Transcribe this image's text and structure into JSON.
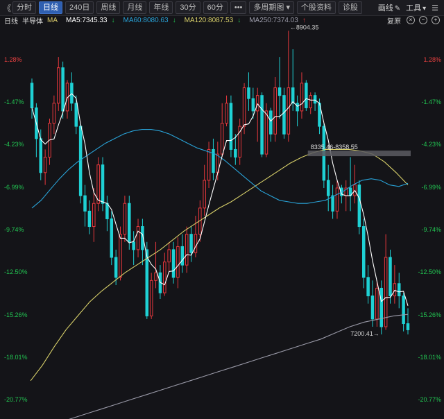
{
  "toolbar": {
    "back": "《",
    "buttons": [
      "分时",
      "日线",
      "240日",
      "周线",
      "月线",
      "年线",
      "30分",
      "60分",
      "•••",
      "多周期图 ▾",
      "个股资料",
      "诊股"
    ],
    "active_index": 1,
    "tools": [
      {
        "label": "画线",
        "icon": "✎"
      },
      {
        "label": "工具",
        "icon": "▾"
      },
      {
        "label": "",
        "icon": "☰"
      }
    ]
  },
  "info": {
    "period": "日线",
    "name": "半导体",
    "ma_label": "MA",
    "ma5": "MA5:7345.33",
    "ma5_arrow": "↓",
    "ma60": "MA60:8080.63",
    "ma60_arrow": "↓",
    "ma120": "MA120:8087.53",
    "ma120_arrow": "↓",
    "ma250": "MA250:7374.03",
    "ma250_arrow": "↑",
    "restore": "复原",
    "colors": {
      "ma5": "#ffffff",
      "ma60": "#29a3d8",
      "ma120": "#d8d06a",
      "ma250": "#9a9aa8",
      "up": "#e8383d",
      "down": "#1fd1d4"
    }
  },
  "axis_labels": {
    "left": [
      "1.28%",
      "-1.47%",
      "-4.23%",
      "-6.99%",
      "-9.74%",
      "-12.50%",
      "-15.26%",
      "-18.01%",
      "-20.77%"
    ],
    "colors": [
      "#e84040",
      "#22c552",
      "#22c552",
      "#22c552",
      "#22c552",
      "#22c552",
      "#22c552",
      "#22c552",
      "#22c552"
    ]
  },
  "annotations": {
    "high": "←8904.35",
    "low": "7200.41→",
    "range": "8335.46-8358.55"
  },
  "chart_data": {
    "type": "candlestick",
    "y_axis": "percent change",
    "y_ticks": [
      1.28,
      -1.47,
      -4.23,
      -6.99,
      -9.74,
      -12.5,
      -15.26,
      -18.01,
      -20.77
    ],
    "ylim": [
      -22.8,
      4.7
    ],
    "candles": [
      [
        -0.2,
        -1.8,
        0.1,
        -2.5
      ],
      [
        -1.8,
        -3.8,
        -1.5,
        -5.0
      ],
      [
        -3.8,
        -6.0,
        -3.2,
        -6.5
      ],
      [
        -6.0,
        -5.0,
        -4.5,
        -6.8
      ],
      [
        -5.0,
        -2.8,
        -2.5,
        -5.5
      ],
      [
        -2.8,
        -1.5,
        -1.0,
        -3.5
      ],
      [
        -1.5,
        0.8,
        1.5,
        -2.0
      ],
      [
        0.8,
        -2.0,
        1.2,
        -2.5
      ],
      [
        -2.0,
        -0.2,
        0.0,
        -2.5
      ],
      [
        -0.2,
        -1.5,
        0.5,
        -2.0
      ],
      [
        -1.5,
        -3.0,
        -1.0,
        -3.5
      ],
      [
        -3.0,
        -7.5,
        -2.8,
        -8.0
      ],
      [
        -7.5,
        -8.5,
        -6.8,
        -9.5
      ],
      [
        -8.5,
        -9.5,
        -7.8,
        -10.0
      ],
      [
        -9.5,
        -8.0,
        -7.0,
        -10.5
      ],
      [
        -8.0,
        -5.5,
        -5.0,
        -8.5
      ],
      [
        -5.5,
        -8.0,
        -5.0,
        -8.5
      ],
      [
        -8.0,
        -9.0,
        -7.5,
        -9.8
      ],
      [
        -9.0,
        -11.5,
        -8.5,
        -12.0
      ],
      [
        -11.5,
        -12.8,
        -11.0,
        -13.3
      ],
      [
        -12.8,
        -10.0,
        -9.5,
        -13.0
      ],
      [
        -10.0,
        -8.0,
        -7.5,
        -10.5
      ],
      [
        -8.0,
        -10.5,
        -7.5,
        -11.0
      ],
      [
        -10.5,
        -11.0,
        -9.8,
        -12.0
      ],
      [
        -11.0,
        -9.5,
        -9.0,
        -11.5
      ],
      [
        -9.5,
        -11.0,
        -9.0,
        -12.0
      ],
      [
        -11.0,
        -15.3,
        -10.5,
        -15.5
      ],
      [
        -15.3,
        -13.0,
        -12.5,
        -15.5
      ],
      [
        -13.0,
        -12.5,
        -10.5,
        -13.5
      ],
      [
        -12.5,
        -13.8,
        -12.0,
        -14.2
      ],
      [
        -13.8,
        -11.8,
        -11.2,
        -14.0
      ],
      [
        -11.8,
        -11.0,
        -10.5,
        -12.5
      ],
      [
        -11.0,
        -12.8,
        -10.5,
        -13.2
      ],
      [
        -12.8,
        -10.8,
        -10.2,
        -13.5
      ],
      [
        -10.8,
        -12.0,
        -10.0,
        -12.5
      ],
      [
        -12.0,
        -10.0,
        -9.5,
        -12.5
      ],
      [
        -10.0,
        -11.2,
        -9.5,
        -11.8
      ],
      [
        -11.2,
        -10.0,
        -8.8,
        -11.5
      ],
      [
        -10.0,
        -8.3,
        -7.8,
        -10.5
      ],
      [
        -8.3,
        -6.5,
        -5.5,
        -8.8
      ],
      [
        -6.5,
        -4.5,
        -4.0,
        -7.0
      ],
      [
        -4.5,
        -6.0,
        -3.8,
        -6.5
      ],
      [
        -6.0,
        -4.8,
        -4.0,
        -6.5
      ],
      [
        -4.8,
        -2.8,
        -1.5,
        -5.0
      ],
      [
        -2.8,
        -1.5,
        -1.0,
        -3.0
      ],
      [
        -1.5,
        -4.5,
        -1.0,
        -5.0
      ],
      [
        -4.5,
        -5.0,
        -3.5,
        -5.5
      ],
      [
        -5.0,
        -3.0,
        -2.5,
        -5.5
      ],
      [
        -3.0,
        -0.5,
        -0.2,
        -3.5
      ],
      [
        -0.5,
        -1.2,
        0.5,
        -2.0
      ],
      [
        -1.2,
        -2.0,
        -0.5,
        -2.5
      ],
      [
        -2.0,
        -1.0,
        -0.5,
        -4.0
      ],
      [
        -1.0,
        -4.8,
        -0.8,
        -5.0
      ],
      [
        -4.8,
        -2.0,
        -1.5,
        -5.0
      ],
      [
        -2.0,
        -3.5,
        -1.8,
        -4.0
      ],
      [
        -3.5,
        -0.5,
        0.2,
        -4.0
      ],
      [
        -0.5,
        -1.0,
        1.5,
        -2.5
      ],
      [
        -1.0,
        -3.5,
        -0.5,
        -3.8
      ],
      [
        -3.5,
        -0.5,
        3.2,
        -4.0
      ],
      [
        -0.5,
        -1.5,
        2.0,
        -2.0
      ],
      [
        -1.5,
        -2.0,
        -1.0,
        -3.0
      ],
      [
        -2.0,
        -0.2,
        0.5,
        -2.5
      ],
      [
        -0.2,
        -1.8,
        0.0,
        -2.0
      ],
      [
        -1.8,
        -1.0,
        -0.8,
        -2.2
      ],
      [
        -1.0,
        -1.5,
        -0.8,
        -2.0
      ],
      [
        -1.5,
        -3.0,
        -1.2,
        -3.5
      ],
      [
        -3.0,
        -6.5,
        -2.8,
        -7.0
      ],
      [
        -6.5,
        -7.5,
        -5.5,
        -8.5
      ],
      [
        -7.5,
        -8.5,
        -6.8,
        -9.0
      ],
      [
        -8.5,
        -7.0,
        -6.5,
        -9.0
      ],
      [
        -7.0,
        -7.5,
        -6.8,
        -8.0
      ],
      [
        -7.5,
        -7.0,
        -6.5,
        -8.5
      ],
      [
        -7.0,
        -7.5,
        -5.0,
        -8.5
      ],
      [
        -7.5,
        -6.8,
        -5.5,
        -8.0
      ],
      [
        -6.8,
        -9.5,
        -6.5,
        -10.0
      ],
      [
        -9.5,
        -12.8,
        -9.0,
        -13.5
      ],
      [
        -12.8,
        -14.0,
        -12.0,
        -14.5
      ],
      [
        -14.0,
        -15.5,
        -13.0,
        -16.0
      ],
      [
        -15.5,
        -13.5,
        -13.0,
        -16.0
      ],
      [
        -13.5,
        -16.0,
        -13.0,
        -16.5
      ],
      [
        -16.0,
        -11.5,
        -10.0,
        -16.2
      ],
      [
        -11.5,
        -14.0,
        -11.0,
        -14.5
      ],
      [
        -14.0,
        -13.2,
        -12.0,
        -14.5
      ],
      [
        -13.2,
        -14.0,
        -12.5,
        -14.8
      ],
      [
        -14.0,
        -15.8,
        -13.8,
        -16.3
      ],
      [
        -15.8,
        -16.2,
        -14.8,
        -16.5
      ]
    ],
    "ma60": [
      -8.3,
      -7.8,
      -7.1,
      -6.4,
      -5.8,
      -5.3,
      -4.9,
      -4.5,
      -4.1,
      -3.8,
      -3.5,
      -3.3,
      -3.2,
      -3.2,
      -3.3,
      -3.5,
      -3.8,
      -4.1,
      -4.4,
      -4.6,
      -4.8,
      -5.2,
      -5.7,
      -6.2,
      -6.7,
      -7.2,
      -7.5,
      -7.8,
      -7.9,
      -8.0,
      -8.0,
      -7.9,
      -7.8,
      -7.5,
      -7.2,
      -6.8,
      -6.5,
      -6.4,
      -6.5,
      -6.8,
      -6.9,
      -6.7
    ],
    "ma120": [
      -19.5,
      -18.5,
      -17.3,
      -16.2,
      -15.3,
      -14.4,
      -13.7,
      -13.1,
      -12.5,
      -12.0,
      -11.5,
      -11.0,
      -10.4,
      -9.8,
      -9.3,
      -8.8,
      -8.3,
      -7.9,
      -7.4,
      -6.9,
      -6.4,
      -5.9,
      -5.4,
      -5.0,
      -4.7,
      -4.5,
      -4.5,
      -4.5,
      -4.6,
      -4.8,
      -5.3,
      -6.0,
      -6.8
    ],
    "ma250": [
      -22.8,
      -22.5,
      -22.2,
      -21.9,
      -21.6,
      -21.3,
      -21.0,
      -20.7,
      -20.4,
      -20.1,
      -19.8,
      -19.5,
      -19.2,
      -18.9,
      -18.6,
      -18.3,
      -18.0,
      -17.7,
      -17.4,
      -17.1,
      -16.8,
      -16.4,
      -16.0,
      -15.7,
      -15.5,
      -15.3,
      -15.2
    ]
  }
}
